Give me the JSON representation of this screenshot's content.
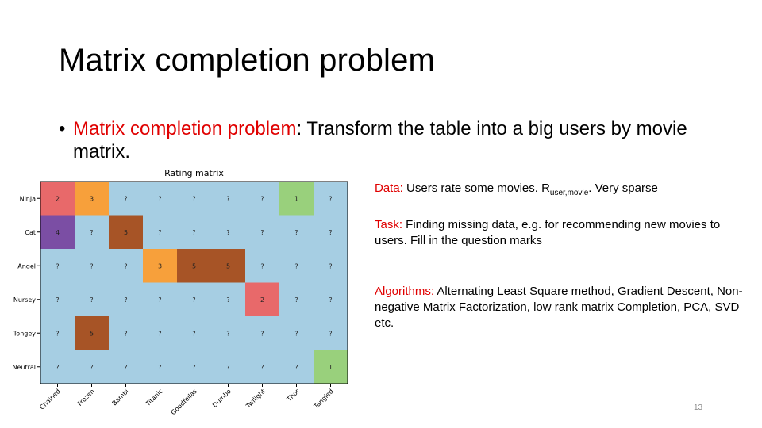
{
  "slide": {
    "title": "Matrix completion problem",
    "bullet_highlight": "Matrix completion problem",
    "bullet_rest": ": Transform the table into a big users by movie matrix.",
    "page_number": "13"
  },
  "side_notes": {
    "data_label": "Data:",
    "data_text_before": " Users rate some movies. R",
    "data_subscript": "user,movie",
    "data_text_after": ". Very sparse",
    "task_label": "Task:",
    "task_text": " Finding missing data, e.g. for recommending new movies to users. Fill in the question marks",
    "algo_label": "Algorithms:",
    "algo_text": " Alternating Least Square method, Gradient Descent, Non-negative Matrix Factorization, low rank matrix Completion, PCA, SVD etc."
  },
  "chart_data": {
    "type": "heatmap",
    "title": "Rating matrix",
    "rows": [
      "Ninja",
      "Cat",
      "Angel",
      "Nursey",
      "Tongey",
      "Neutral"
    ],
    "columns": [
      "Chained",
      "Frozen",
      "Bambi",
      "Titanic",
      "Goodfellas",
      "Dumbo",
      "Twilight",
      "Thor",
      "Tangled"
    ],
    "cells": [
      [
        "2",
        "3",
        "?",
        "?",
        "?",
        "?",
        "?",
        "1",
        "?"
      ],
      [
        "4",
        "?",
        "5",
        "?",
        "?",
        "?",
        "?",
        "?",
        "?"
      ],
      [
        "?",
        "?",
        "?",
        "3",
        "5",
        "5",
        "?",
        "?",
        "?"
      ],
      [
        "?",
        "?",
        "?",
        "?",
        "?",
        "?",
        "2",
        "?",
        "?"
      ],
      [
        "?",
        "5",
        "?",
        "?",
        "?",
        "?",
        "?",
        "?",
        "?"
      ],
      [
        "?",
        "?",
        "?",
        "?",
        "?",
        "?",
        "?",
        "?",
        "1"
      ]
    ],
    "color_scale": {
      "?": "#a6cee3",
      "1": "#99d07c",
      "2": "#e8696a",
      "3": "#f7a03b",
      "4": "#7b4ea4",
      "5": "#a75426"
    }
  }
}
